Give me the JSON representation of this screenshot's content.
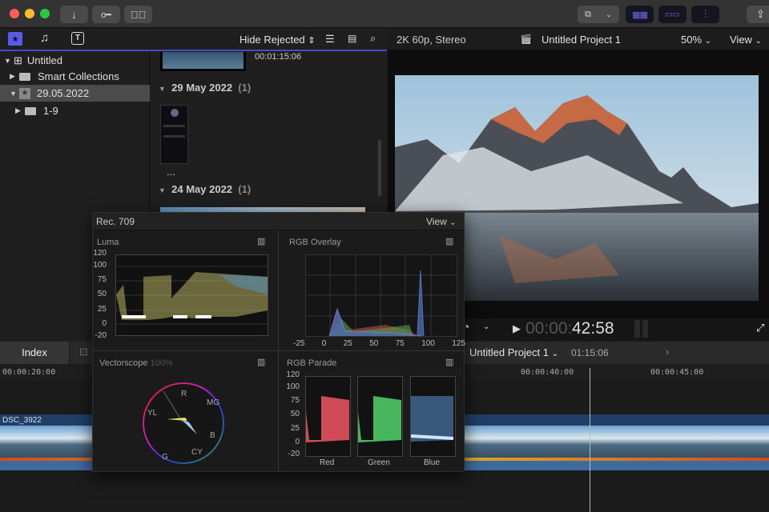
{
  "titlebar": {
    "import_icon": "download-arrow",
    "keywords_icon": "key-icon",
    "check_icon": "checkmark-circle",
    "workspace_icon": "display-icon",
    "share_icon": "share-icon"
  },
  "browser_toolbar": {
    "filter": "Hide Rejected"
  },
  "sidebar": {
    "items": [
      {
        "label": "Untitled",
        "expanded": true
      },
      {
        "label": "Smart Collections",
        "expanded": false
      },
      {
        "label": "29.05.2022",
        "expanded": true,
        "selected": true
      },
      {
        "label": "1-9",
        "expanded": false
      }
    ]
  },
  "browser": {
    "clip_duration": "00:01:15:06",
    "groups": [
      {
        "date": "29 May 2022",
        "count": "(1)",
        "more": "..."
      },
      {
        "date": "24 May 2022",
        "count": "(1)"
      }
    ]
  },
  "viewer": {
    "format": "2K 60p, Stereo",
    "project": "Untitled Project 1",
    "zoom": "50%",
    "view": "View",
    "timecode_dim": "00:00:",
    "timecode": "42:58"
  },
  "timeline": {
    "index_tab": "Index",
    "project": "Untitled Project 1",
    "duration": "01:15:06",
    "ruler": [
      "00:00:20:00",
      "00:00:40:00",
      "00:00:45:00"
    ],
    "clip_name": "DSC_3922"
  },
  "scopes": {
    "title": "Rec. 709",
    "view": "View",
    "luma": {
      "label": "Luma",
      "ticks": [
        "120",
        "100",
        "75",
        "50",
        "25",
        "0",
        "-20"
      ]
    },
    "overlay": {
      "label": "RGB Overlay",
      "ticks": [
        "-25",
        "0",
        "25",
        "50",
        "75",
        "100",
        "125"
      ]
    },
    "vectorscope": {
      "label": "Vectorscope",
      "zoom": "100%",
      "targets": [
        "R",
        "MG",
        "YL",
        "B",
        "G",
        "CY"
      ]
    },
    "parade": {
      "label": "RGB Parade",
      "ticks": [
        "120",
        "100",
        "75",
        "50",
        "25",
        "0",
        "-20"
      ],
      "channels": [
        "Red",
        "Green",
        "Blue"
      ]
    },
    "colors": {
      "red": "#ff5a6a",
      "green": "#55e070",
      "blue": "#6ab0ff"
    }
  }
}
